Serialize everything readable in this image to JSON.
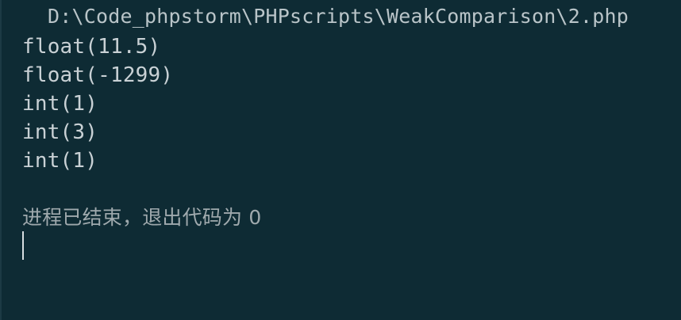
{
  "console": {
    "path_line": "D:\\Code_phpstorm\\PHPscripts\\WeakComparison\\2.php",
    "output": [
      "float(11.5)",
      "float(-1299)",
      "int(1)",
      "int(3)",
      "int(1)"
    ],
    "exit_message": "进程已结束，退出代码为 0"
  }
}
